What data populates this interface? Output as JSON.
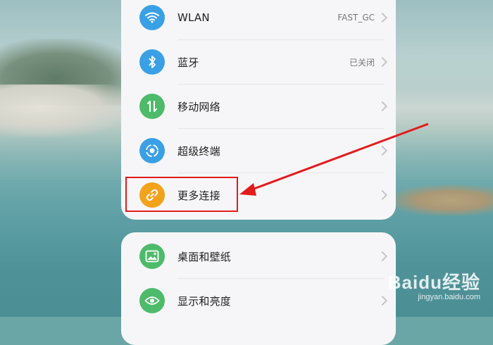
{
  "settings_group_1": {
    "items": [
      {
        "id": "wlan",
        "label": "WLAN",
        "value": "FAST_GC",
        "icon": "wifi-icon",
        "icon_color": "#3aa0e6"
      },
      {
        "id": "bluetooth",
        "label": "蓝牙",
        "value": "已关闭",
        "icon": "bluetooth-icon",
        "icon_color": "#3aa0e6"
      },
      {
        "id": "mobile_network",
        "label": "移动网络",
        "value": "",
        "icon": "mobile-data-icon",
        "icon_color": "#4dbb6a"
      },
      {
        "id": "super_terminal",
        "label": "超级终端",
        "value": "",
        "icon": "super-terminal-icon",
        "icon_color": "#3aa0e6"
      },
      {
        "id": "more_connections",
        "label": "更多连接",
        "value": "",
        "icon": "link-icon",
        "icon_color": "#f3a21c"
      }
    ]
  },
  "settings_group_2": {
    "items": [
      {
        "id": "desktop_wallpaper",
        "label": "桌面和壁纸",
        "value": "",
        "icon": "image-icon",
        "icon_color": "#4dbb6a"
      },
      {
        "id": "display_brightness",
        "label": "显示和亮度",
        "value": "",
        "icon": "eye-icon",
        "icon_color": "#4dbb6a"
      }
    ]
  },
  "annotation": {
    "highlight_color": "#e31b1b",
    "target": "more_connections"
  },
  "watermark": {
    "brand": "Baidu经验",
    "url": "jingyan.baidu.com"
  }
}
